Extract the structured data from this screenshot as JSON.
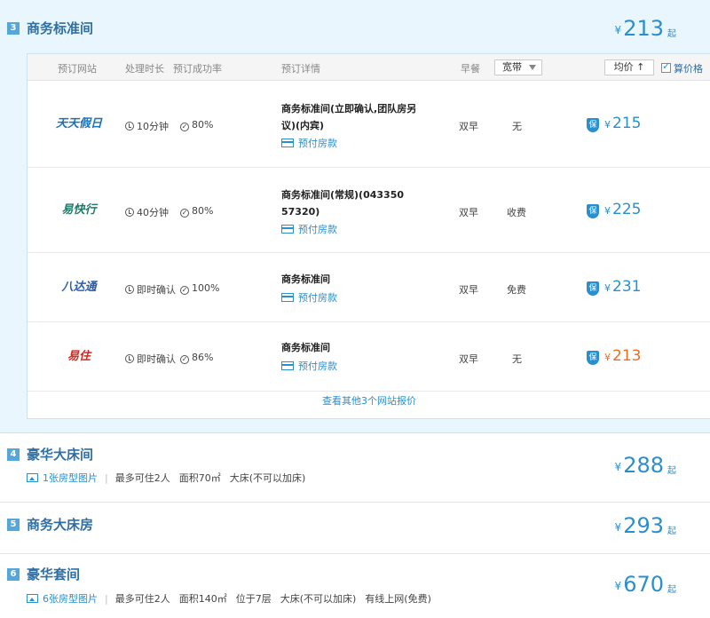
{
  "colors": {
    "accent": "#2a8fcf",
    "title": "#2f6fa5",
    "low_price": "#f26b1d",
    "badge": "#55a7d9"
  },
  "room3": {
    "number": "3",
    "title": "商务标准间",
    "currency": "¥",
    "price": "213",
    "price_suffix": "起",
    "headers": {
      "site": "预订网站",
      "process_time": "处理时长",
      "success_rate": "预订成功率",
      "detail": "预订详情",
      "breakfast": "早餐",
      "broadband": "宽带",
      "sort": "均价 ↑",
      "calc_price": "算价格"
    },
    "offers": [
      {
        "site": "天天假日",
        "site_color": "#1b6fb3",
        "time": "10分钟",
        "rate": "80%",
        "detail": "商务标准间(立即确认,团队房另议)(内宾)",
        "payment": "预付房款",
        "breakfast": "双早",
        "broadband": "无",
        "price": "215",
        "lowest": false
      },
      {
        "site": "易快行",
        "site_color": "#1f7a6a",
        "time": "40分钟",
        "rate": "80%",
        "detail": "商务标准间(常规)(043350 57320)",
        "payment": "预付房款",
        "breakfast": "双早",
        "broadband": "收费",
        "price": "225",
        "lowest": false
      },
      {
        "site": "八达通",
        "site_color": "#2a5db0",
        "time": "即时确认",
        "rate": "100%",
        "detail": "商务标准间",
        "payment": "预付房款",
        "breakfast": "双早",
        "broadband": "免费",
        "price": "231",
        "lowest": false
      },
      {
        "site": "易住",
        "site_color": "#d8261c",
        "time": "即时确认",
        "rate": "86%",
        "detail": "商务标准间",
        "payment": "预付房款",
        "breakfast": "双早",
        "broadband": "无",
        "price": "213",
        "lowest": true
      }
    ],
    "more_link": "查看其他3个网站报价"
  },
  "room4": {
    "number": "4",
    "title": "豪华大床间",
    "currency": "¥",
    "price": "288",
    "price_suffix": "起",
    "pictures": "1张房型图片",
    "features": [
      "最多可住2人",
      "面积70㎡",
      "大床(不可以加床)"
    ]
  },
  "room5": {
    "number": "5",
    "title": "商务大床房",
    "currency": "¥",
    "price": "293",
    "price_suffix": "起"
  },
  "room6": {
    "number": "6",
    "title": "豪华套间",
    "currency": "¥",
    "price": "670",
    "price_suffix": "起",
    "pictures": "6张房型图片",
    "features": [
      "最多可住2人",
      "面积140㎡",
      "位于7层",
      "大床(不可以加床)",
      "有线上网(免费)"
    ]
  },
  "icons": {
    "time": "clock-icon",
    "rate": "check-circle-icon",
    "payment": "card-icon",
    "guarantee": "shield-bao-icon",
    "pictures": "image-icon"
  }
}
